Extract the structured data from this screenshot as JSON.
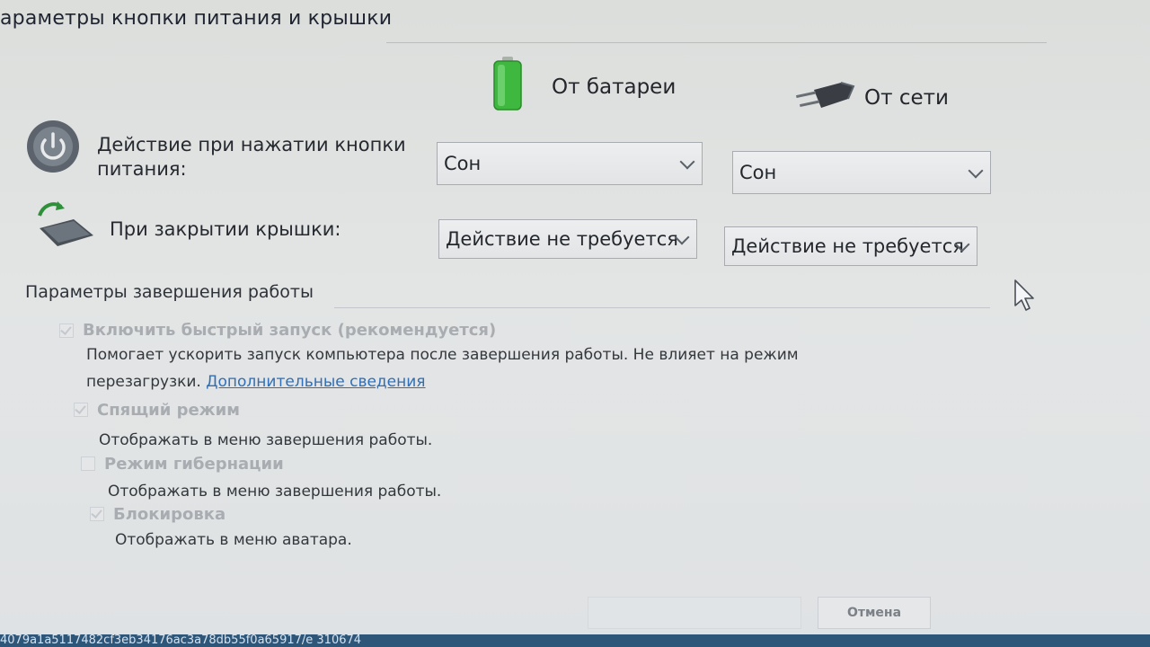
{
  "window": {
    "title": "араметры кнопки питания и крышки"
  },
  "columns": {
    "battery_label": "От батареи",
    "ac_label": "От сети"
  },
  "power_button": {
    "label": "Действие при нажатии кнопки питания:",
    "battery_value": "Сон",
    "ac_value": "Сон"
  },
  "lid": {
    "label": "При закрытии крышки:",
    "battery_value": "Действие не требуется",
    "ac_value": "Действие не требуется"
  },
  "shutdown": {
    "heading": "Параметры завершения работы",
    "fast_startup": {
      "label": "Включить быстрый запуск (рекомендуется)",
      "desc_line1": "Помогает ускорить запуск компьютера после завершения работы. Не влияет на режим",
      "desc_line2": "перезагрузки.",
      "link": "Дополнительные сведения",
      "checked": true
    },
    "sleep": {
      "label": "Спящий режим",
      "desc": "Отображать в меню завершения работы.",
      "checked": true
    },
    "hibernate": {
      "label": "Режим гибернации",
      "desc": "Отображать в меню завершения работы.",
      "checked": false
    },
    "lock": {
      "label": "Блокировка",
      "desc": "Отображать в меню аватара.",
      "checked": true
    }
  },
  "buttons": {
    "cancel": "Отмена"
  },
  "status_bar": {
    "text": "4079a1a5117482cf3eb34176ac3a78db55f0a65917/e        310674"
  },
  "colors": {
    "accent_link": "#2f6fb7",
    "battery_green": "#3fb83f",
    "status_bar": "#2d5679"
  },
  "icons": {
    "power": "power-button-icon",
    "lid": "laptop-lid-icon",
    "battery": "battery-icon",
    "plug": "power-plug-icon",
    "cursor": "mouse-cursor-icon"
  }
}
